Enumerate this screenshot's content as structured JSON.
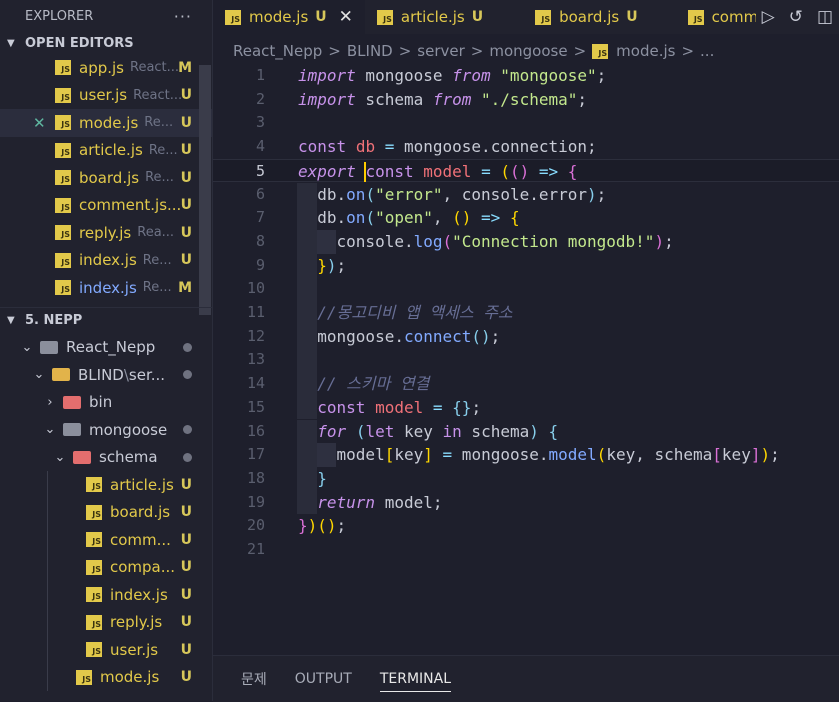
{
  "sidebar": {
    "title": "EXPLORER",
    "more": "···",
    "open_editors_label": "OPEN EDITORS",
    "open_editors": [
      {
        "name": "app.js",
        "path": "React...",
        "badge": "M",
        "selected": false
      },
      {
        "name": "user.js",
        "path": "React...",
        "badge": "U",
        "selected": false
      },
      {
        "name": "mode.js",
        "path": "Re...",
        "badge": "U",
        "selected": true
      },
      {
        "name": "article.js",
        "path": "Re...",
        "badge": "U",
        "selected": false
      },
      {
        "name": "board.js",
        "path": "Re...",
        "badge": "U",
        "selected": false
      },
      {
        "name": "comment.js...",
        "path": "",
        "badge": "U",
        "selected": false
      },
      {
        "name": "reply.js",
        "path": "Rea...",
        "badge": "U",
        "selected": false
      },
      {
        "name": "index.js",
        "path": "Re...",
        "badge": "U",
        "selected": false
      },
      {
        "name": "index.js",
        "path": "Re...",
        "badge": "M",
        "selected": false
      }
    ],
    "workspace_label": "5. NEPP",
    "tree": {
      "react_nepp": "React_Nepp",
      "blind": "BLIND",
      "blind_sep": "\\",
      "blind_rest": "ser...",
      "bin": "bin",
      "mongoose": "mongoose",
      "schema": "schema",
      "schema_files": [
        {
          "name": "article.js",
          "badge": "U"
        },
        {
          "name": "board.js",
          "badge": "U"
        },
        {
          "name": "comm...",
          "badge": "U"
        },
        {
          "name": "compa...",
          "badge": "U"
        },
        {
          "name": "index.js",
          "badge": "U"
        },
        {
          "name": "reply.js",
          "badge": "U"
        },
        {
          "name": "user.js",
          "badge": "U"
        }
      ],
      "mode_file": {
        "name": "mode.js",
        "badge": "U"
      }
    },
    "js_icon": "JS"
  },
  "tabs": [
    {
      "name": "mode.js",
      "badge": "U",
      "active": true,
      "close": "✕"
    },
    {
      "name": "article.js",
      "badge": "U",
      "active": false
    },
    {
      "name": "board.js",
      "badge": "U",
      "active": false
    },
    {
      "name": "comm",
      "badge": "",
      "active": false
    }
  ],
  "breadcrumb": {
    "parts": [
      "React_Nepp",
      "BLIND",
      "server",
      "mongoose"
    ],
    "file": "mode.js",
    "tail": "...",
    "separator": ">"
  },
  "editor": {
    "line_numbers": [
      "1",
      "2",
      "3",
      "4",
      "5",
      "6",
      "7",
      "8",
      "9",
      "10",
      "11",
      "12",
      "13",
      "14",
      "15",
      "16",
      "17",
      "18",
      "19",
      "20",
      "21"
    ],
    "current_line": 5
  },
  "panel": {
    "tabs": [
      "문제",
      "OUTPUT",
      "TERMINAL"
    ],
    "active": "TERMINAL"
  },
  "colors": {
    "background": "#1e1f2c",
    "sidebar": "#21222e",
    "js_icon": "#e2c94a",
    "keyword": "#c792ea",
    "string": "#c3e88d",
    "variable": "#f07178",
    "function": "#82aaff",
    "comment": "#676e95"
  }
}
